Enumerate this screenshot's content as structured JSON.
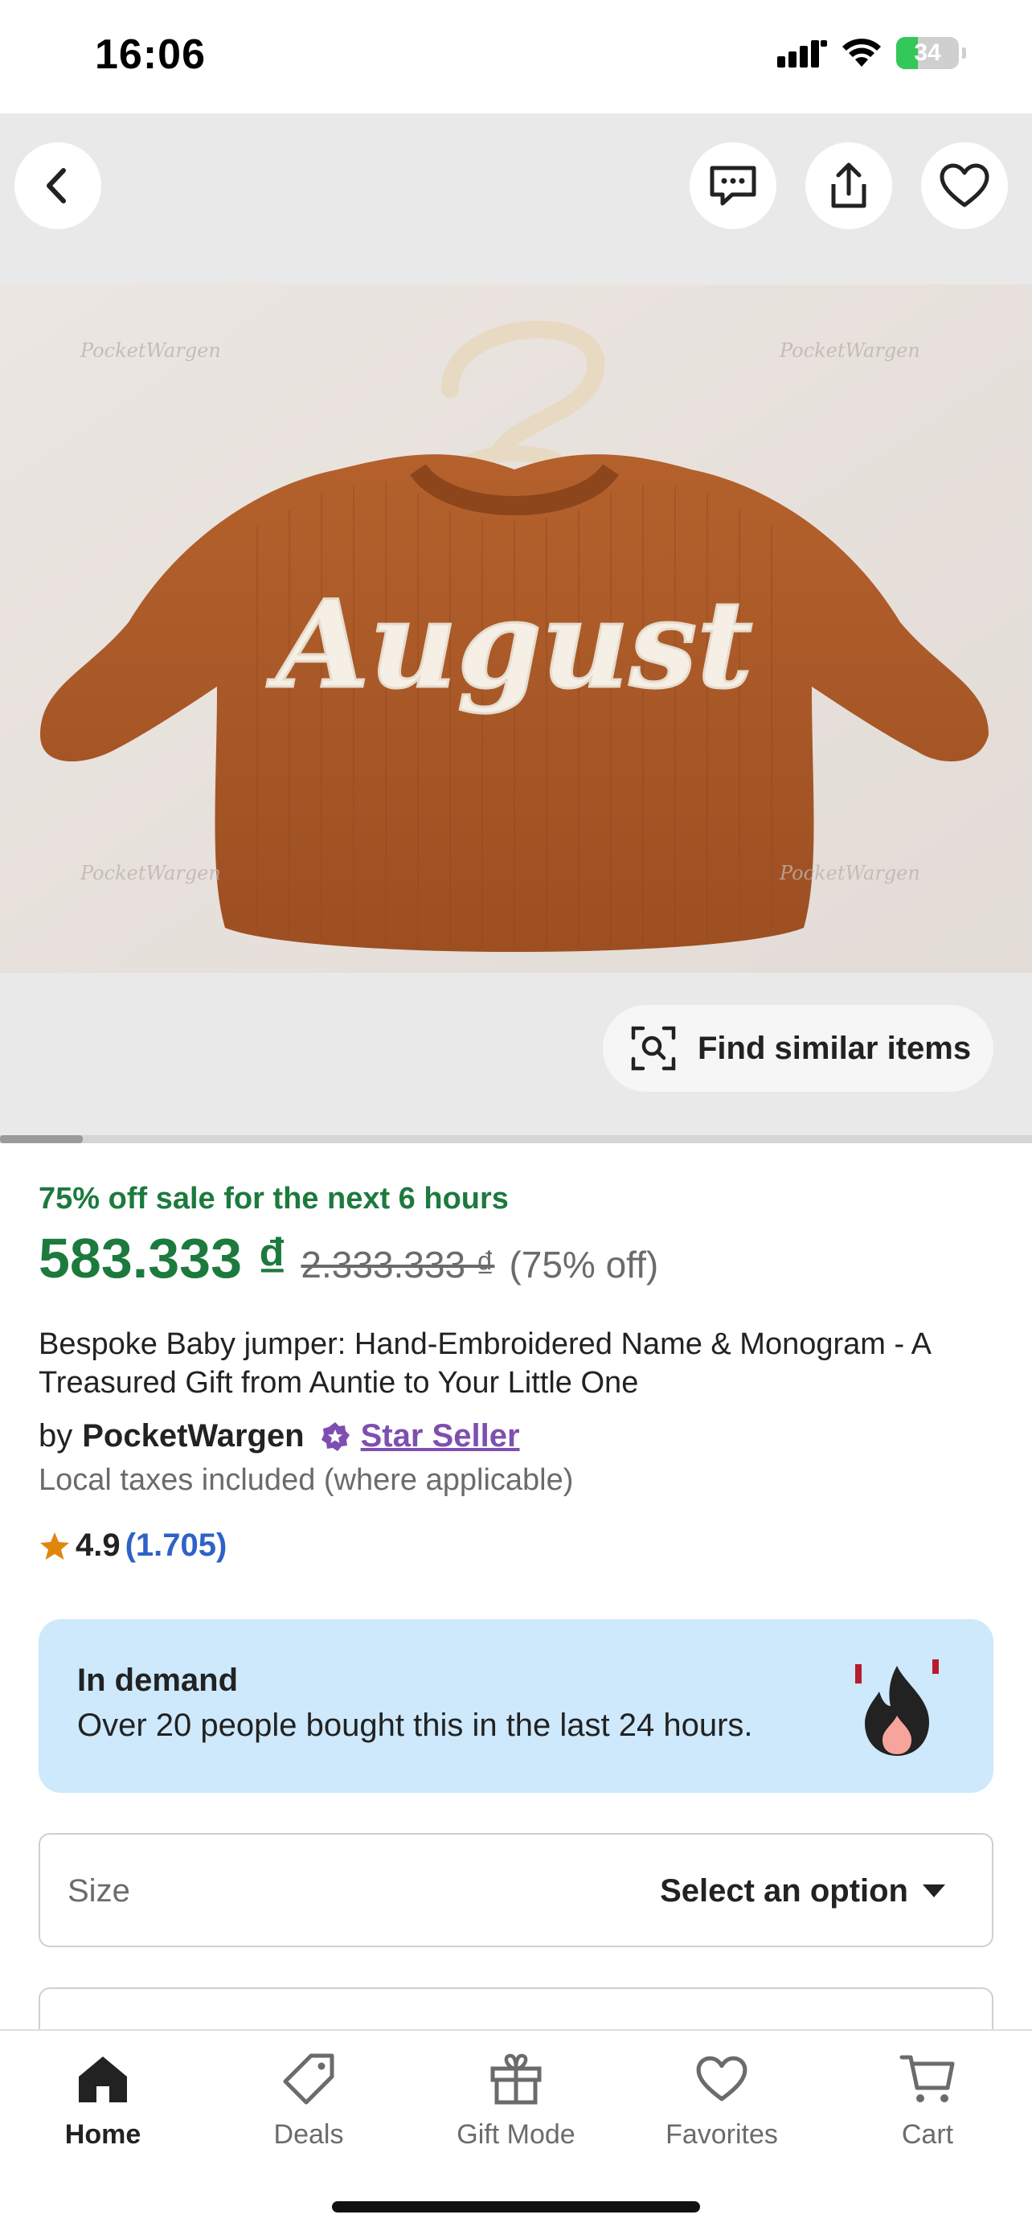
{
  "status_bar": {
    "time": "16:06",
    "battery": "34",
    "battery_level": 0.34
  },
  "header": {
    "back_icon": "chevron-left-icon",
    "message_icon": "message-icon",
    "share_icon": "share-icon",
    "favorite_icon": "heart-icon"
  },
  "media": {
    "find_similar_label": "Find similar items",
    "image_progress": 0.08,
    "photo_text": "August",
    "watermark": "PocketWargen"
  },
  "listing": {
    "sale_note": "75% off sale for the next 6 hours",
    "price": "583.333 ₫",
    "original_price": "2.333.333 ₫",
    "discount": "(75% off)",
    "title": "Bespoke Baby jumper: Hand-Embroidered Name & Monogram - A Treasured Gift from Auntie to Your Little One",
    "seller_prefix": "by",
    "seller_name": "PocketWargen",
    "seller_badge": "Star Seller",
    "taxes_note": "Local taxes included (where applicable)",
    "rating": "4.9",
    "rating_count": "(1.705)"
  },
  "demand": {
    "title": "In demand",
    "text": "Over 20 people bought this in the last 24 hours."
  },
  "size_select": {
    "label": "Size",
    "value": "Select an option"
  },
  "tabs": [
    {
      "label": "Home",
      "icon": "home-icon",
      "active": true
    },
    {
      "label": "Deals",
      "icon": "tag-icon",
      "active": false
    },
    {
      "label": "Gift Mode",
      "icon": "gift-icon",
      "active": false
    },
    {
      "label": "Favorites",
      "icon": "heart-icon",
      "active": false
    },
    {
      "label": "Cart",
      "icon": "cart-icon",
      "active": false
    }
  ],
  "colors": {
    "green": "#1c7a3d",
    "purple": "#7e4fb0",
    "link_blue": "#2f62c6",
    "demand_bg": "#cde9fb"
  }
}
